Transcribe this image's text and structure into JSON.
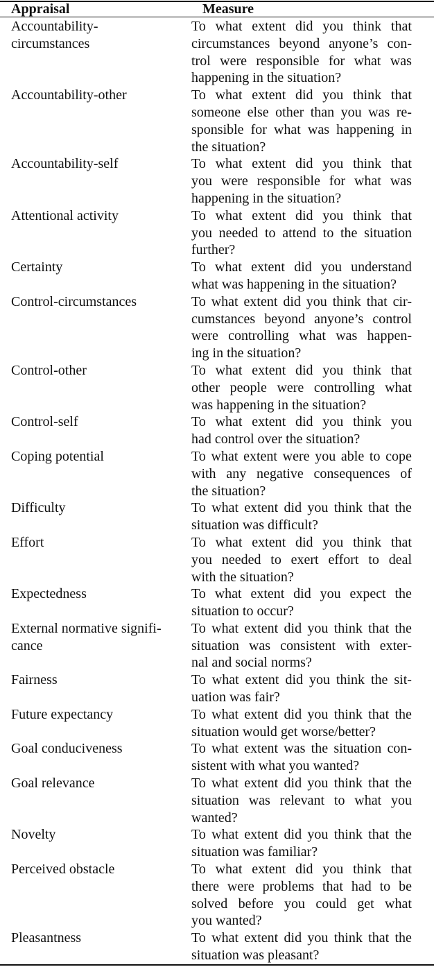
{
  "table": {
    "headers": {
      "appraisal": "Appraisal",
      "measure": "Measure"
    },
    "rows": [
      {
        "appraisal": [
          "Accountability-",
          "circumstances"
        ],
        "measure": [
          "To what extent did you think that",
          "circumstances beyond anyone’s con-",
          "trol were responsible for what was",
          "happening in the situation?"
        ]
      },
      {
        "appraisal": [
          "Accountability-other"
        ],
        "measure": [
          "To what extent did you think that",
          "someone else other than you was re-",
          "sponsible for what was happening in",
          "the situation?"
        ]
      },
      {
        "appraisal": [
          "Accountability-self"
        ],
        "measure": [
          "To what extent did you think that",
          "you were responsible for what was",
          "happening in the situation?"
        ]
      },
      {
        "appraisal": [
          "Attentional activity"
        ],
        "measure": [
          "To what extent did you think that",
          "you needed to attend to the situation",
          "further?"
        ]
      },
      {
        "appraisal": [
          "Certainty"
        ],
        "measure": [
          "To what extent did you understand",
          "what was happening in the situation?"
        ]
      },
      {
        "appraisal": [
          "Control-circumstances"
        ],
        "measure": [
          "To what extent did you think that cir-",
          "cumstances beyond anyone’s control",
          "were controlling what was happen-",
          "ing in the situation?"
        ]
      },
      {
        "appraisal": [
          "Control-other"
        ],
        "measure": [
          "To what extent did you think that",
          "other people were controlling what",
          "was happening in the situation?"
        ]
      },
      {
        "appraisal": [
          "Control-self"
        ],
        "measure": [
          "To what extent did you think you",
          "had control over the situation?"
        ]
      },
      {
        "appraisal": [
          "Coping potential"
        ],
        "measure": [
          "To what extent were you able to cope",
          "with any negative consequences of",
          "the situation?"
        ]
      },
      {
        "appraisal": [
          "Difficulty"
        ],
        "measure": [
          "To what extent did you think that the",
          "situation was difficult?"
        ]
      },
      {
        "appraisal": [
          "Effort"
        ],
        "measure": [
          "To what extent did you think that",
          "you needed to exert effort to deal",
          "with the situation?"
        ]
      },
      {
        "appraisal": [
          "Expectedness"
        ],
        "measure": [
          "To what extent did you expect the",
          "situation to occur?"
        ]
      },
      {
        "appraisal": [
          "External normative signifi-",
          "cance"
        ],
        "measure": [
          "To what extent did you think that the",
          "situation was consistent with exter-",
          "nal and social norms?"
        ]
      },
      {
        "appraisal": [
          "Fairness"
        ],
        "measure": [
          "To what extent did you think the sit-",
          "uation was fair?"
        ]
      },
      {
        "appraisal": [
          "Future expectancy"
        ],
        "measure": [
          "To what extent did you think that the",
          "situation would get worse/better?"
        ]
      },
      {
        "appraisal": [
          "Goal conduciveness"
        ],
        "measure": [
          "To what extent was the situation con-",
          "sistent with what you wanted?"
        ]
      },
      {
        "appraisal": [
          "Goal relevance"
        ],
        "measure": [
          "To what extent did you think that the",
          "situation was relevant to what you",
          "wanted?"
        ]
      },
      {
        "appraisal": [
          "Novelty"
        ],
        "measure": [
          "To what extent did you think that the",
          "situation was familiar?"
        ]
      },
      {
        "appraisal": [
          "Perceived obstacle"
        ],
        "measure": [
          "To what extent did you think that",
          "there were problems that had to be",
          "solved before you could get what",
          "you wanted?"
        ]
      },
      {
        "appraisal": [
          "Pleasantness"
        ],
        "measure": [
          "To what extent did you think that the",
          "situation was pleasant?"
        ]
      }
    ]
  }
}
